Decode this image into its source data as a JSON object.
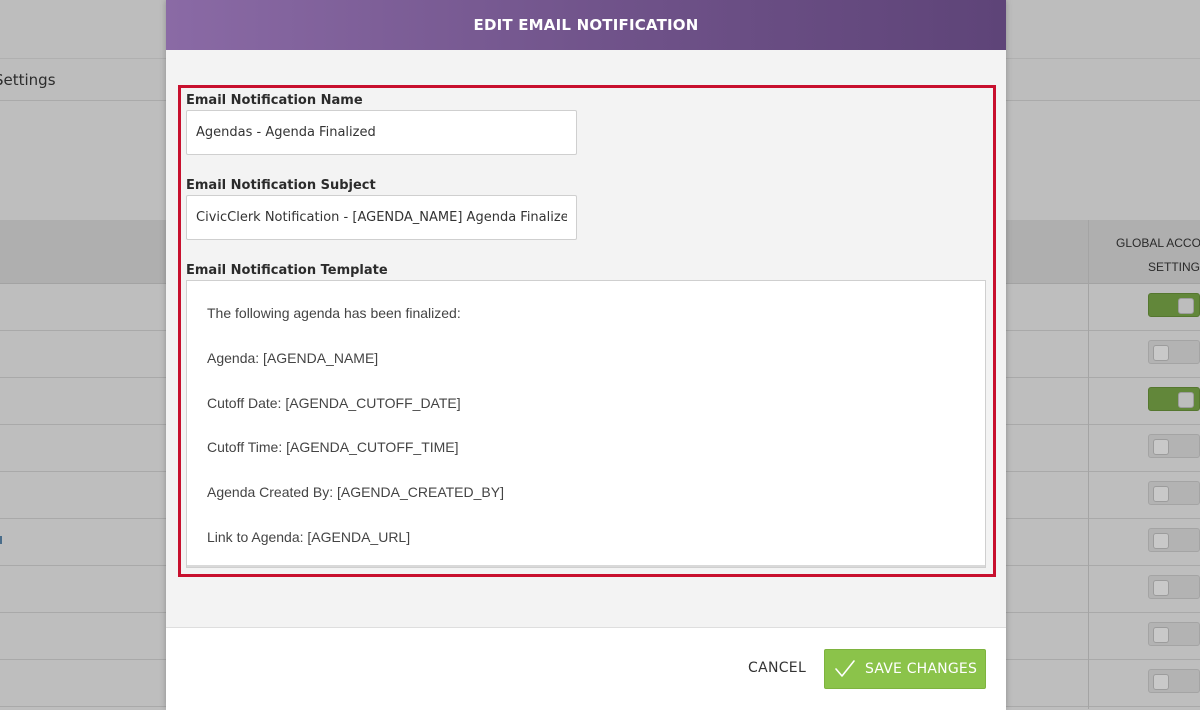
{
  "background": {
    "settings_label": "Settings",
    "column_header": {
      "line1": "GLOBAL ACCO",
      "line2": "SETTING"
    },
    "toggles": [
      {
        "state": "on"
      },
      {
        "state": "off"
      },
      {
        "state": "on"
      },
      {
        "state": "off"
      },
      {
        "state": "off"
      },
      {
        "state": "off"
      },
      {
        "state": "off"
      },
      {
        "state": "off"
      },
      {
        "state": "off"
      }
    ]
  },
  "modal": {
    "title": "EDIT EMAIL NOTIFICATION",
    "name_field": {
      "label": "Email Notification Name",
      "value": "Agendas - Agenda Finalized"
    },
    "subject_field": {
      "label": "Email Notification Subject",
      "value": "CivicClerk Notification - [AGENDA_NAME] Agenda Finalized"
    },
    "template_field": {
      "label": "Email Notification Template",
      "lines": [
        "The following agenda has been finalized:",
        "Agenda: [AGENDA_NAME]",
        "Cutoff Date: [AGENDA_CUTOFF_DATE]",
        "Cutoff Time: [AGENDA_CUTOFF_TIME]",
        "Agenda Created By: [AGENDA_CREATED_BY]",
        "Link to Agenda: [AGENDA_URL]"
      ]
    },
    "footer": {
      "cancel_label": "CANCEL",
      "save_label": "SAVE CHANGES",
      "save_icon": "checkmark-icon"
    }
  },
  "colors": {
    "header_purple": "#6f5289",
    "highlight_red": "#c8102e",
    "save_green": "#8bc34a",
    "toggle_on_green": "#62873a"
  }
}
